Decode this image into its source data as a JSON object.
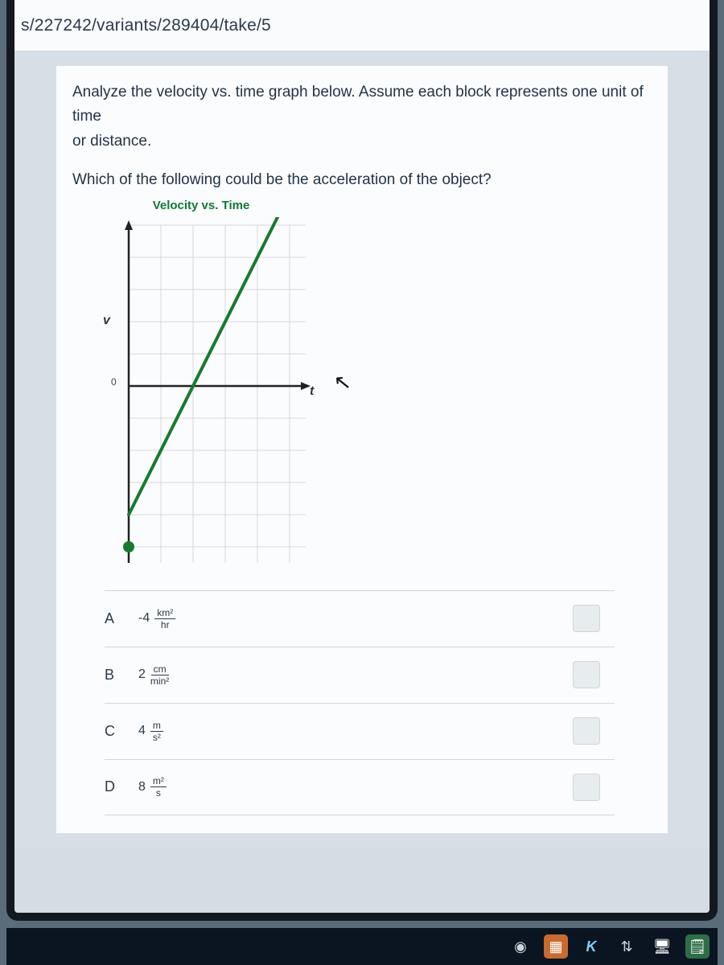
{
  "url_fragment": "s/227242/variants/289404/take/5",
  "question": {
    "stem_line1": "Analyze the velocity vs. time graph below. Assume each block represents one unit of time",
    "stem_line2": "or distance.",
    "sub": "Which of the following could be the acceleration of the object?"
  },
  "chart": {
    "title": "Velocity vs. Time",
    "y_axis_label": "v",
    "x_axis_label": "t",
    "zero_label": "0"
  },
  "choices": [
    {
      "letter": "A",
      "coef": "-4",
      "num": "km²",
      "den": "hr"
    },
    {
      "letter": "B",
      "coef": "2",
      "num": "cm",
      "den": "min²"
    },
    {
      "letter": "C",
      "coef": "4",
      "num": "m",
      "den": "s²"
    },
    {
      "letter": "D",
      "coef": "8",
      "num": "m²",
      "den": "s"
    }
  ],
  "chart_data": {
    "type": "line",
    "title": "Velocity vs. Time",
    "xlabel": "t",
    "ylabel": "v",
    "grid": true,
    "xlim": [
      0,
      5
    ],
    "ylim": [
      -5,
      5
    ],
    "series": [
      {
        "name": "velocity",
        "x": [
          0,
          1,
          2,
          3,
          4,
          5
        ],
        "values": [
          -4,
          -2,
          0,
          2,
          4,
          6
        ]
      }
    ],
    "note": "Straight line with positive slope 2 units per unit; starts near v = -4 at t = 0."
  },
  "taskbar_icons": [
    {
      "name": "record-icon",
      "glyph": "◉",
      "bg": "#0b1522",
      "fg": "#cfd6db"
    },
    {
      "name": "box-icon",
      "glyph": "▦",
      "bg": "#c96a2e",
      "fg": "#fff"
    },
    {
      "name": "k-icon",
      "glyph": "K",
      "bg": "#0b1522",
      "fg": "#7ad0ff"
    },
    {
      "name": "devices-icon",
      "glyph": "⇅",
      "bg": "#0b1522",
      "fg": "#cfd6db"
    },
    {
      "name": "monitor-icon",
      "glyph": "🖥",
      "bg": "#0b1522",
      "fg": "#cfd6db"
    },
    {
      "name": "note-icon",
      "glyph": "🗒",
      "bg": "#2e6e46",
      "fg": "#fff"
    }
  ]
}
